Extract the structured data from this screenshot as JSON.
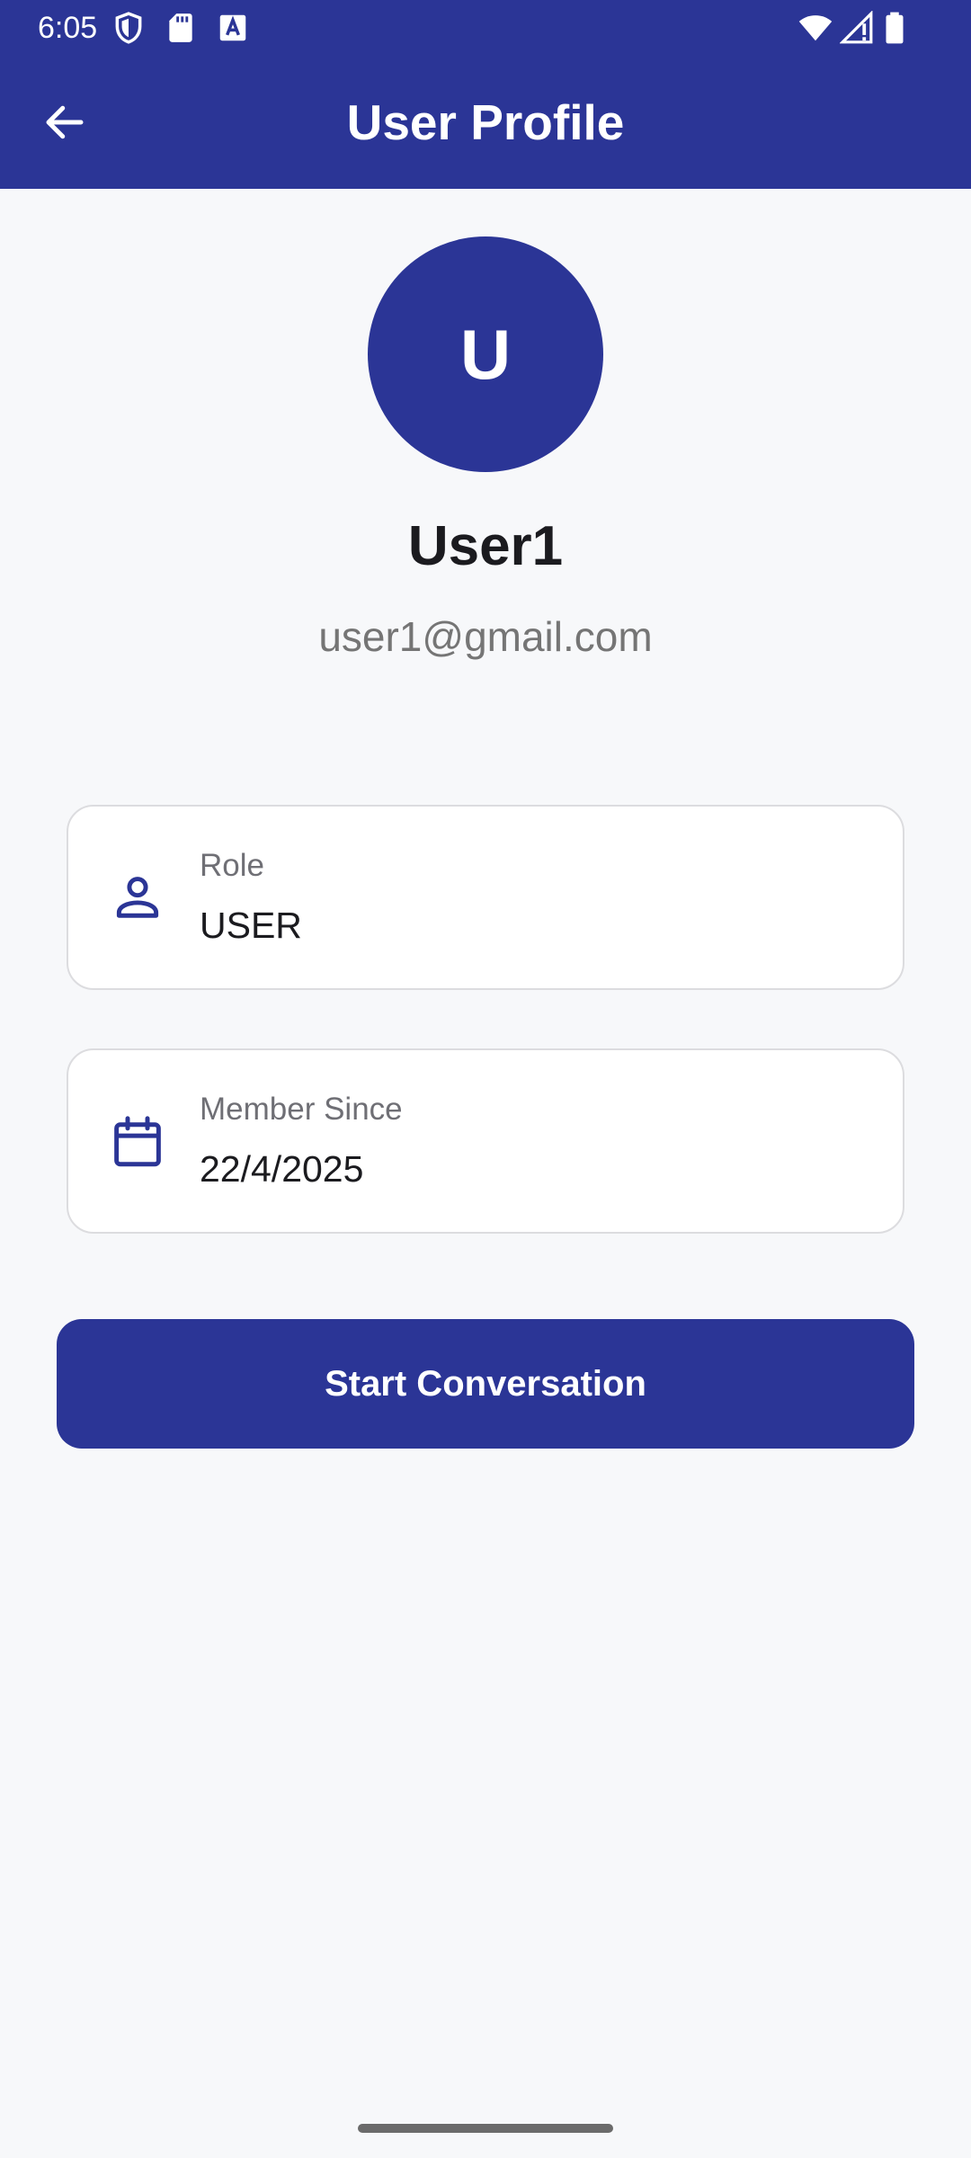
{
  "status_bar": {
    "time": "6:05",
    "icons": [
      "shield-icon",
      "sd-card-icon",
      "keyboard-a-icon",
      "wifi-icon",
      "signal-icon",
      "battery-icon"
    ]
  },
  "app_bar": {
    "title": "User Profile",
    "back_icon": "arrow-left-icon"
  },
  "profile": {
    "avatar_letter": "U",
    "name": "User1",
    "email": "user1@gmail.com"
  },
  "cards": {
    "role": {
      "icon": "person-icon",
      "label": "Role",
      "value": "USER"
    },
    "member_since": {
      "icon": "calendar-icon",
      "label": "Member Since",
      "value": "22/4/2025"
    }
  },
  "actions": {
    "start_conversation_label": "Start Conversation"
  },
  "colors": {
    "primary": "#2b3596",
    "background": "#f7f8fa",
    "card_border": "#dcdcdf",
    "text_primary": "#1b1b1f",
    "text_secondary": "#757575"
  }
}
